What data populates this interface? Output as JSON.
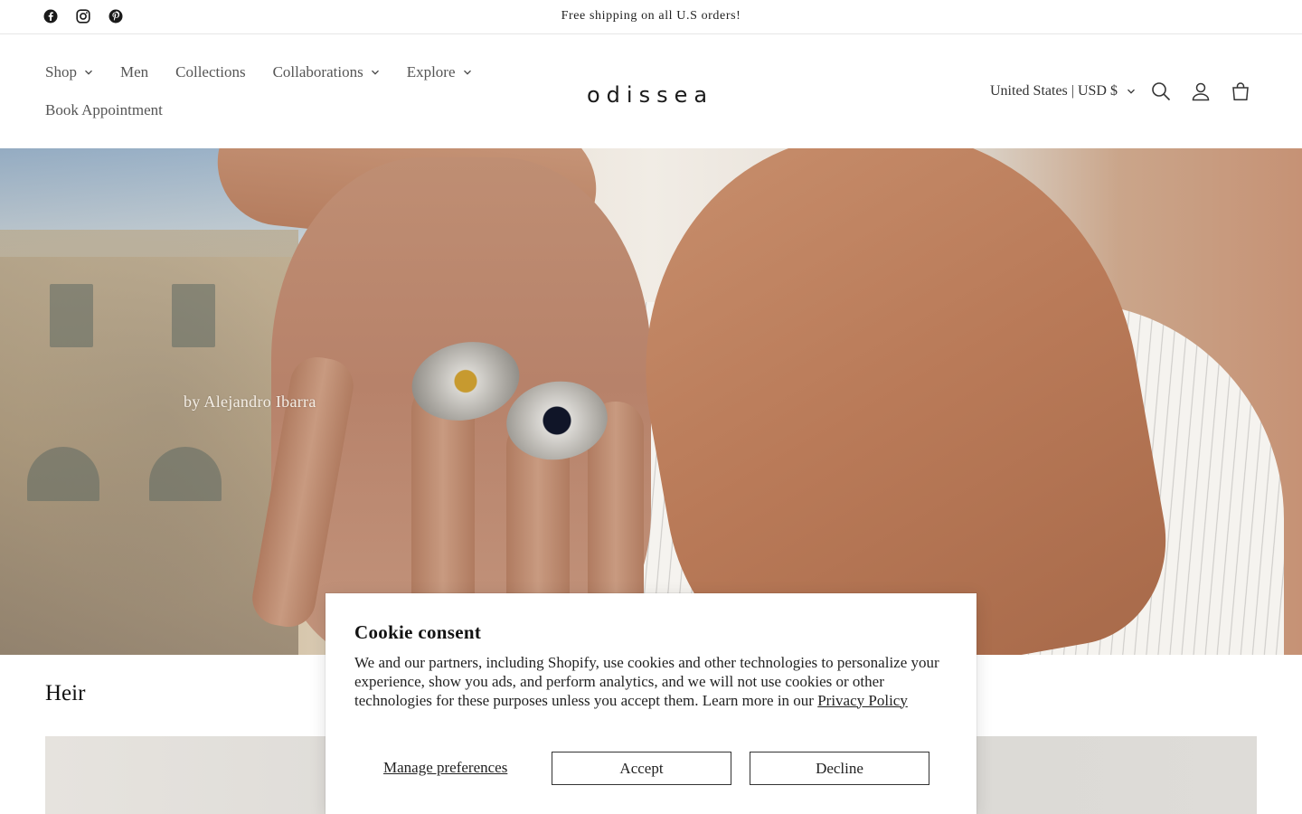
{
  "announcement": {
    "text": "Free shipping on all U.S orders!",
    "social_icons": [
      "facebook-icon",
      "instagram-icon",
      "pinterest-icon"
    ]
  },
  "header": {
    "nav": [
      {
        "label": "Shop",
        "has_dropdown": true
      },
      {
        "label": "Men",
        "has_dropdown": false
      },
      {
        "label": "Collections",
        "has_dropdown": false
      },
      {
        "label": "Collaborations",
        "has_dropdown": true
      },
      {
        "label": "Explore",
        "has_dropdown": true
      },
      {
        "label": "Book Appointment",
        "has_dropdown": false
      }
    ],
    "logo": "odissea",
    "locale": "United States | USD $",
    "icons": [
      "search-icon",
      "account-icon",
      "cart-icon"
    ]
  },
  "hero": {
    "caption": "by Alejandro Ibarra"
  },
  "section": {
    "title": "Heir"
  },
  "cookie": {
    "title": "Cookie consent",
    "body": "We and our partners, including Shopify, use cookies and other technologies to personalize your experience, show you ads, and perform analytics, and we will not use cookies or other technologies for these purposes unless you accept them. Learn more in our",
    "link": "Privacy Policy",
    "manage": "Manage preferences",
    "accept": "Accept",
    "decline": "Decline"
  },
  "colors": {
    "text": "#333333",
    "border": "#e6e6e6",
    "button_border": "#333333",
    "background": "#ffffff"
  }
}
